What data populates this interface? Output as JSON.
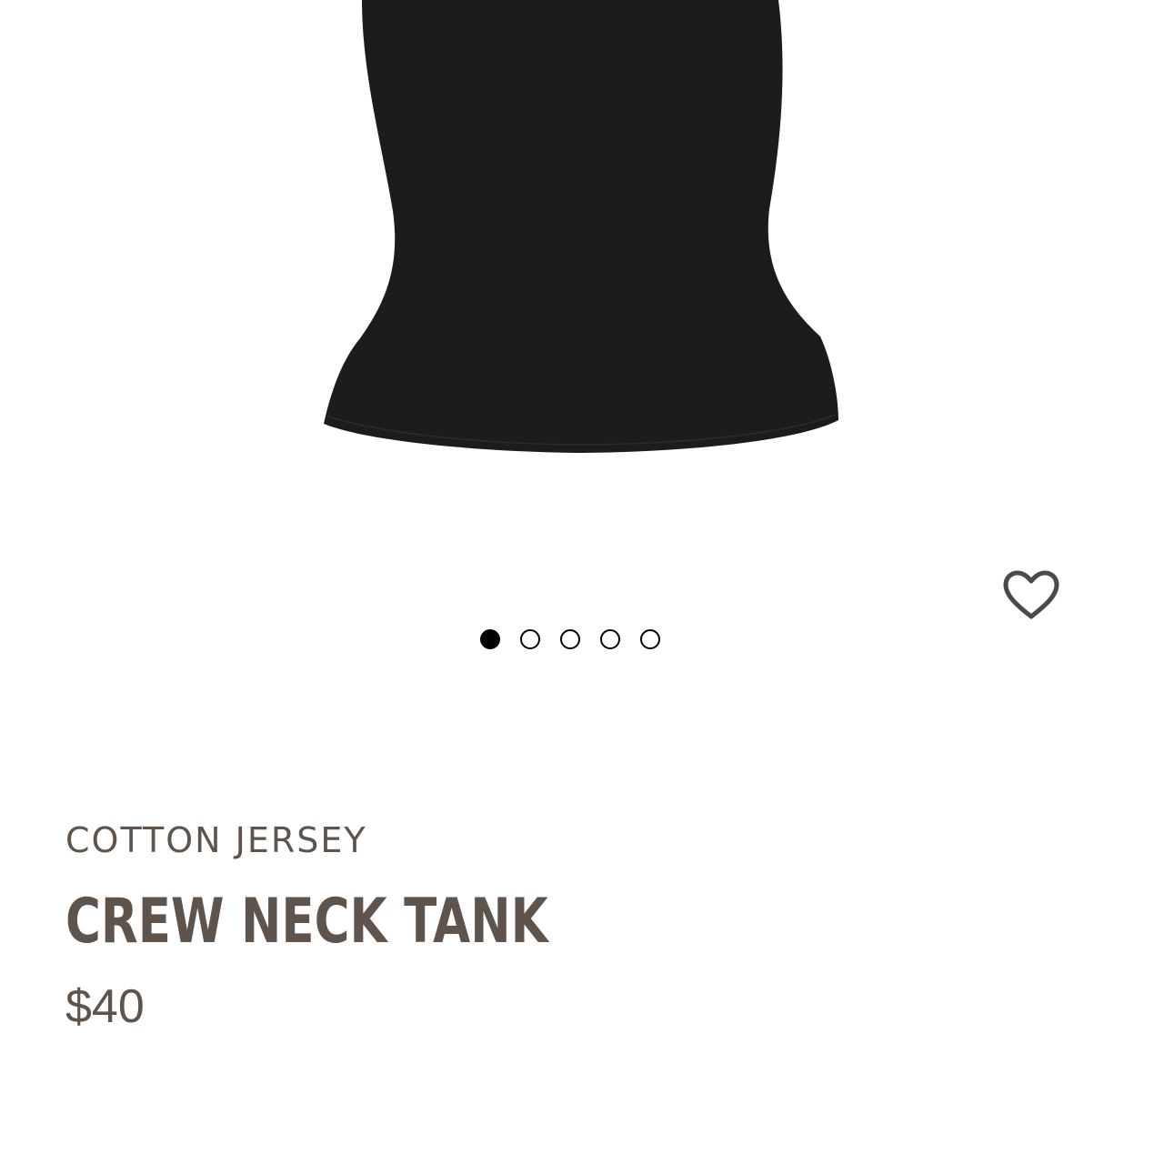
{
  "product": {
    "collection": "COTTON JERSEY",
    "title": "CREW NECK TANK",
    "price": "$40",
    "image_description_icon": "black-tank-top-image"
  },
  "carousel": {
    "total_images": 5,
    "active_index": 0
  },
  "favorite": {
    "icon": "heart-outline-icon",
    "favorited": false
  },
  "colors": {
    "text": "#5f544b",
    "garment": "#1c1c1e",
    "dot": "#000000",
    "heart_stroke": "#4a4a4a"
  }
}
